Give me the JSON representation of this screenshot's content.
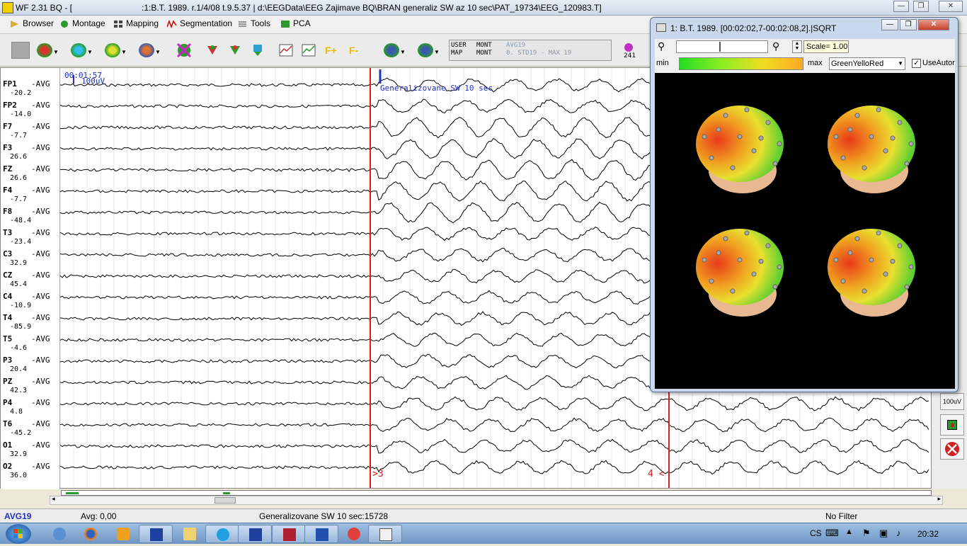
{
  "window": {
    "title": "WF 2.31 BQ - [",
    "title_detail": ":1:B.T. 1989.  r.1/4/08 t.9.5.37 | d:\\EEGData\\EEG Zajimave BQ\\BRAN generaliz SW az 10 sec\\PAT_19734\\EEG_120983.T]"
  },
  "menu": {
    "items": [
      {
        "label": "Browser",
        "icon": "browser-icon"
      },
      {
        "label": "Montage",
        "icon": "montage-icon"
      },
      {
        "label": "Mapping",
        "icon": "mapping-icon"
      },
      {
        "label": "Segmentation",
        "icon": "segmentation-icon"
      },
      {
        "label": "Tools",
        "icon": "tools-icon"
      },
      {
        "label": "PCA",
        "icon": "pca-icon"
      }
    ]
  },
  "info": {
    "l1": "USER",
    "l2": "MAP",
    "m1": "MONT",
    "m2": "MONT",
    "r1": "AVG19",
    "r2": "0. STD19 - MAX 19"
  },
  "eeg": {
    "time": "00:01:57",
    "scale": "100uV",
    "annotation": "Generalizovane SW 10 sec",
    "marker_left": ">3",
    "marker_right": "4 <",
    "channels": [
      {
        "name": "FP1",
        "ref": "-AVG",
        "value": "-20.2"
      },
      {
        "name": "FP2",
        "ref": "-AVG",
        "value": "-14.0"
      },
      {
        "name": "F7",
        "ref": "-AVG",
        "value": "-7.7"
      },
      {
        "name": "F3",
        "ref": "-AVG",
        "value": "26.6"
      },
      {
        "name": "FZ",
        "ref": "-AVG",
        "value": "26.6"
      },
      {
        "name": "F4",
        "ref": "-AVG",
        "value": "-7.7"
      },
      {
        "name": "F8",
        "ref": "-AVG",
        "value": "-48.4"
      },
      {
        "name": "T3",
        "ref": "-AVG",
        "value": "-23.4"
      },
      {
        "name": "C3",
        "ref": "-AVG",
        "value": "32.9"
      },
      {
        "name": "CZ",
        "ref": "-AVG",
        "value": "45.4"
      },
      {
        "name": "C4",
        "ref": "-AVG",
        "value": "-10.9"
      },
      {
        "name": "T4",
        "ref": "-AVG",
        "value": "-85.9"
      },
      {
        "name": "T5",
        "ref": "-AVG",
        "value": "-4.6"
      },
      {
        "name": "P3",
        "ref": "-AVG",
        "value": "20.4"
      },
      {
        "name": "PZ",
        "ref": "-AVG",
        "value": "42.3"
      },
      {
        "name": "P4",
        "ref": "-AVG",
        "value": "4.8"
      },
      {
        "name": "T6",
        "ref": "-AVG",
        "value": "-45.2"
      },
      {
        "name": "O1",
        "ref": "-AVG",
        "value": "32.9"
      },
      {
        "name": "O2",
        "ref": "-AVG",
        "value": "36.0"
      }
    ]
  },
  "right_panel": {
    "scale_label": "100uV"
  },
  "status": {
    "montage": "AVG19",
    "avg": "Avg: 0,00",
    "segment": "Generalizovane SW 10 sec:15728",
    "filter": "No Filter"
  },
  "popup": {
    "title": "1: B.T. 1989.  [00:02:02,7-00:02:08,2].|SQRT",
    "scale": "Scale= 1.00",
    "min_label": "min",
    "max_label": "max",
    "palette": "GreenYelloRed",
    "use_auto": "UseAutor",
    "use_auto_checked": "✓"
  },
  "taskbar": {
    "lang": "CS",
    "clock": "20:32"
  }
}
